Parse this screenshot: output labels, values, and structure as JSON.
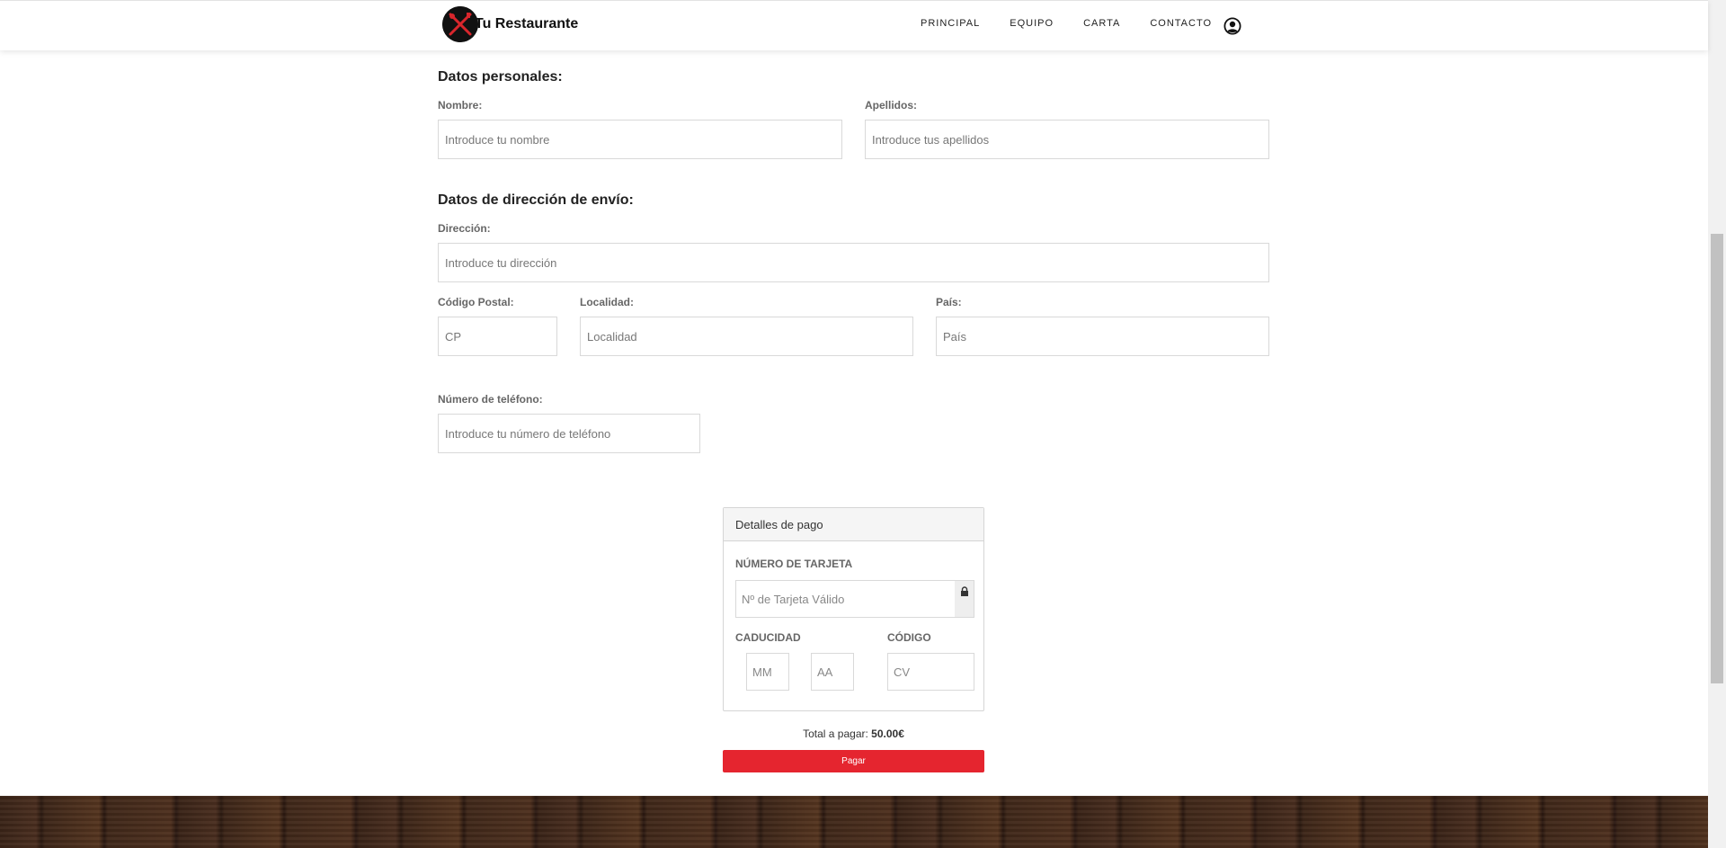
{
  "header": {
    "brand": "Tu Restaurante",
    "nav": [
      "PRINCIPAL",
      "EQUIPO",
      "CARTA",
      "CONTACTO"
    ],
    "user_icon": "user-circle-icon",
    "logo_icon": "crossed-fork-knife-icon"
  },
  "personal": {
    "title": "Datos personales:",
    "nombre_label": "Nombre:",
    "nombre_placeholder": "Introduce tu nombre",
    "apellidos_label": "Apellidos:",
    "apellidos_placeholder": "Introduce tus apellidos"
  },
  "address": {
    "title": "Datos de dirección de envío:",
    "direccion_label": "Dirección:",
    "direccion_placeholder": "Introduce tu dirección",
    "cp_label": "Código Postal:",
    "cp_placeholder": "CP",
    "localidad_label": "Localidad:",
    "localidad_placeholder": "Localidad",
    "pais_label": "País:",
    "pais_placeholder": "País",
    "telefono_label": "Número de teléfono:",
    "telefono_placeholder": "Introduce tu número de teléfono"
  },
  "payment": {
    "heading": "Detalles de pago",
    "card_label": "NÚMERO DE TARJETA",
    "card_placeholder": "Nº de Tarjeta Válido",
    "lock_icon": "lock-icon",
    "expiry_label": "CADUCIDAD",
    "mm_placeholder": "MM",
    "aa_placeholder": "AA",
    "code_label": "CÓDIGO",
    "cv_placeholder": "CV",
    "total_prefix": "Total a pagar:",
    "total_value": "50.00€",
    "pay_button": "Pagar"
  },
  "colors": {
    "accent": "#e5252f",
    "wood": "#3a2418"
  }
}
